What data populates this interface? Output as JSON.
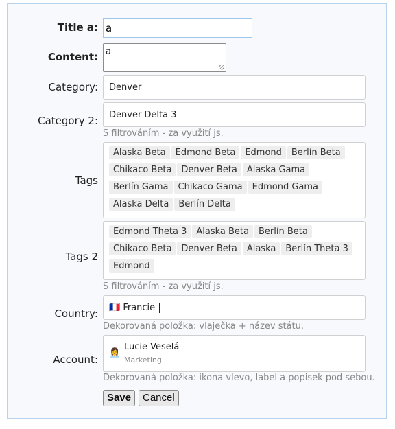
{
  "form": {
    "title_label": "Title a:",
    "title_value": "a",
    "content_label": "Content:",
    "content_value": "a",
    "category_label": "Category:",
    "category_value": "Denver",
    "category2_label": "Category 2:",
    "category2_value": "Denver Delta 3",
    "filter_hint": "S filtrováním - za využití js.",
    "tags_label": "Tags",
    "tags": [
      "Alaska Beta",
      "Edmond Beta",
      "Edmond",
      "Berlín Beta",
      "Chikaco Beta",
      "Denver Beta",
      "Alaska Gama",
      "Berlín Gama",
      "Chikaco Gama",
      "Edmond Gama",
      "Alaska Delta",
      "Berlín Delta"
    ],
    "tags2_label": "Tags 2",
    "tags2": [
      "Edmond Theta 3",
      "Alaska Beta",
      "Berlín Beta",
      "Chikaco Beta",
      "Denver Beta",
      "Alaska",
      "Berlín Theta 3",
      "Edmond"
    ],
    "filter_hint2": "S filtrováním - za využití js.",
    "country_label": "Country:",
    "country_flag": "🇫🇷",
    "country_value": "Francie",
    "country_hint": "Dekorovaná položka: vlaječka + název státu.",
    "account_label": "Account:",
    "account_icon": "👩‍💼",
    "account_name": "Lucie Veselá",
    "account_desc": "Marketing",
    "account_hint": "Dekorovaná položka: ikona vlevo, label a popisek pod sebou.",
    "save_label": "Save",
    "cancel_label": "Cancel"
  }
}
